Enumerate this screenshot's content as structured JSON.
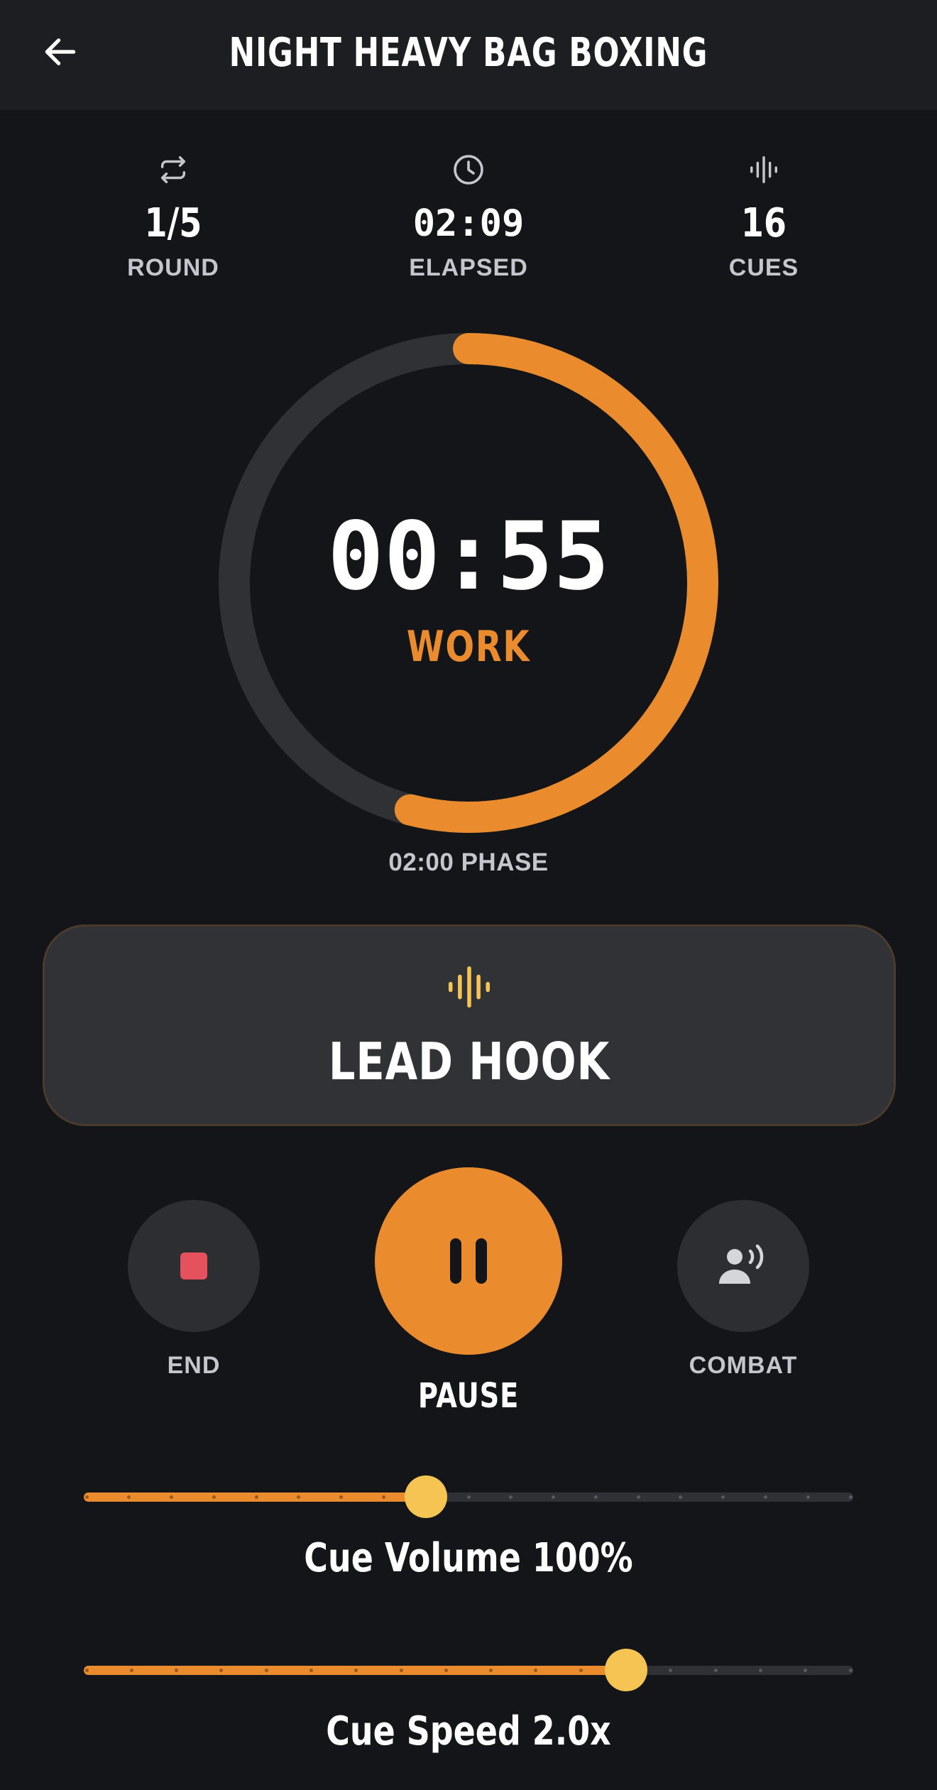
{
  "header": {
    "title": "NIGHT HEAVY BAG BOXING",
    "back_icon": "arrow-left-icon"
  },
  "stats": {
    "round": {
      "value": "1/5",
      "label": "ROUND",
      "icon": "repeat-icon"
    },
    "elapsed": {
      "value": "02:09",
      "label": "ELAPSED",
      "icon": "clock-icon"
    },
    "cues": {
      "value": "16",
      "label": "CUES",
      "icon": "waveform-icon"
    }
  },
  "timer": {
    "remaining": "00:55",
    "phase": "WORK",
    "phase_duration": "02:00 PHASE",
    "progress": 0.54
  },
  "cue_card": {
    "icon": "waveform-icon",
    "text": "LEAD HOOK"
  },
  "controls": {
    "end": {
      "label": "END",
      "icon": "stop-icon"
    },
    "pause": {
      "label": "PAUSE",
      "icon": "pause-icon"
    },
    "combat": {
      "label": "COMBAT",
      "icon": "voice-icon"
    }
  },
  "sliders": {
    "volume": {
      "label": "Cue Volume 100%",
      "fraction": 0.445,
      "steps": 18
    },
    "speed": {
      "label": "Cue Speed 2.0x",
      "fraction": 0.705,
      "steps": 17
    }
  },
  "colors": {
    "accent": "#ea8b2d",
    "thumb": "#f5c452",
    "stop": "#e5525e",
    "background": "#141518",
    "card": "#303236"
  }
}
